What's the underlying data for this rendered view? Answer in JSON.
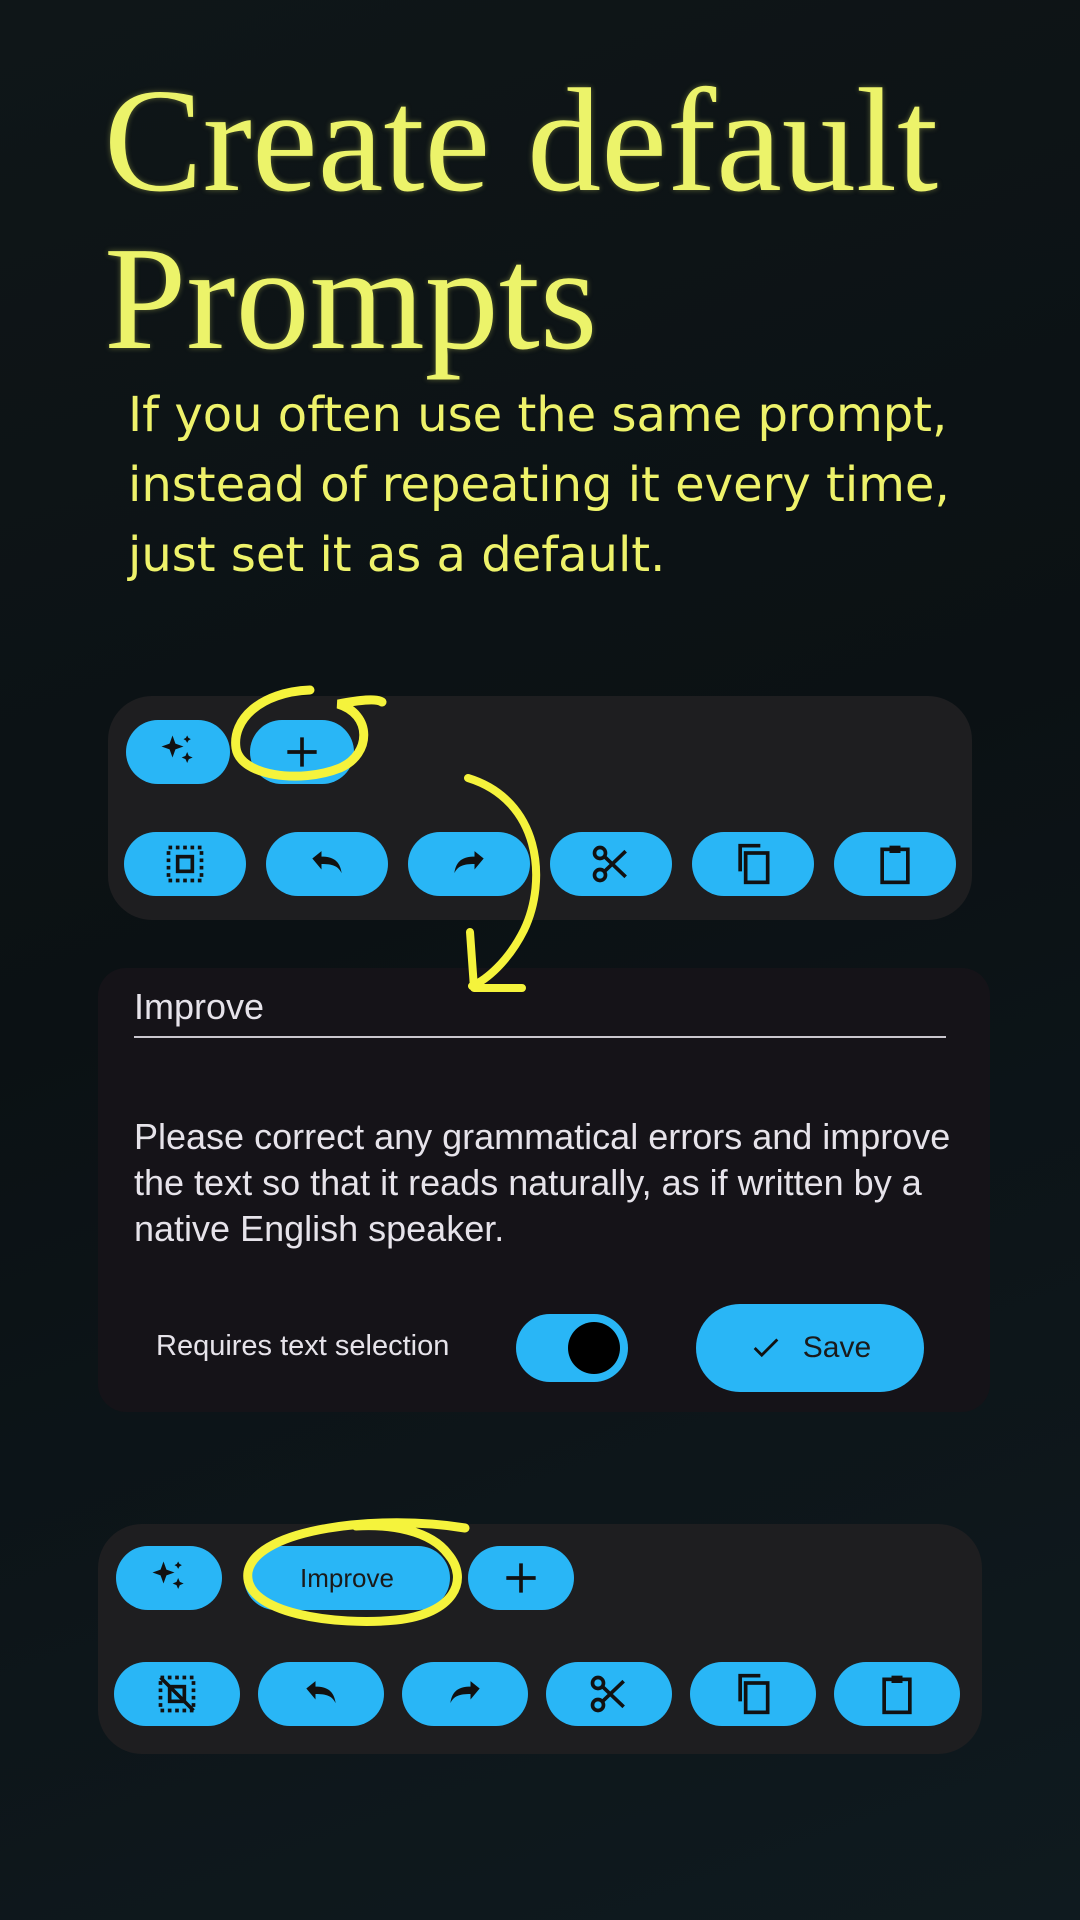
{
  "headline": {
    "line1": "Create default",
    "line2": "Prompts"
  },
  "subtitle": "If you often use the same prompt, instead of repeating it every time, just set it as a default.",
  "toolbar_top": {
    "row1": [
      "sparkles-icon",
      "plus-icon"
    ],
    "row2": [
      "select-all-icon",
      "undo-icon",
      "redo-icon",
      "cut-icon",
      "copy-icon",
      "paste-icon"
    ]
  },
  "editor": {
    "title_value": "Improve",
    "prompt_value": "Please correct any grammatical errors and improve the text so that it reads naturally, as if written by a native English speaker.",
    "requires_selection_label": "Requires text selection",
    "requires_selection_on": true,
    "save_label": "Save"
  },
  "toolbar_bottom": {
    "prompt_chip_label": "Improve",
    "row2": [
      "deselect-icon",
      "undo-icon",
      "redo-icon",
      "cut-icon",
      "copy-icon",
      "paste-icon"
    ]
  },
  "colors": {
    "accent": "#29b6f6",
    "highlight": "#f5f33c",
    "headline": "#ecf36a",
    "panel": "#1e1e20",
    "card": "#151318"
  }
}
